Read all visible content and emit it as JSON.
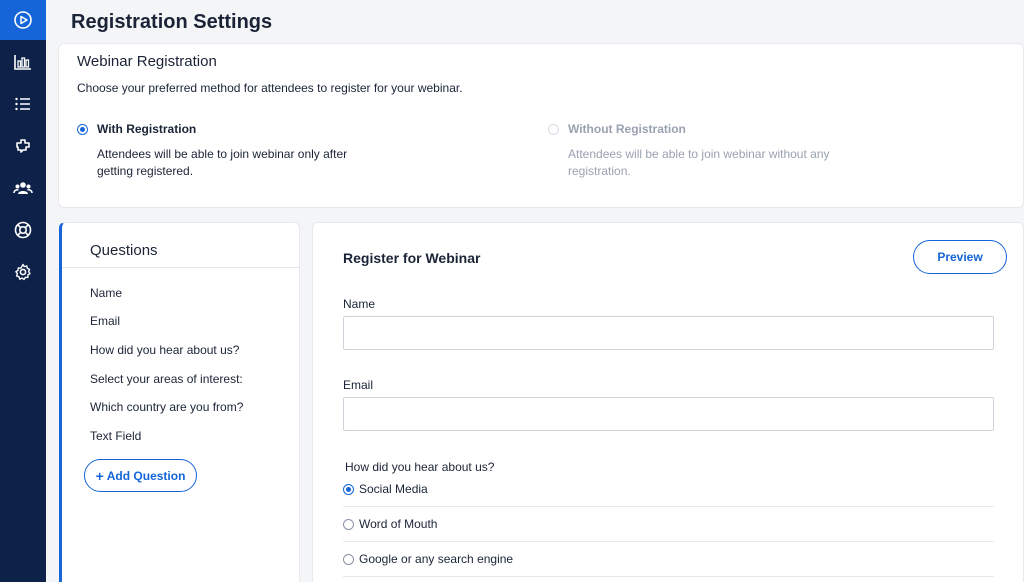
{
  "page": {
    "title": "Registration Settings"
  },
  "sidebar": {
    "items": [
      {
        "icon": "play-circle-icon",
        "active": true
      },
      {
        "icon": "bar-chart-icon",
        "active": false
      },
      {
        "icon": "list-icon",
        "active": false
      },
      {
        "icon": "integrations-icon",
        "active": false
      },
      {
        "icon": "users-icon",
        "active": false
      },
      {
        "icon": "help-lifebuoy-icon",
        "active": false
      },
      {
        "icon": "gear-icon",
        "active": false
      }
    ]
  },
  "webinar_registration": {
    "title": "Webinar Registration",
    "description": "Choose your preferred method for attendees to register for your webinar.",
    "options": [
      {
        "label": "With Registration",
        "description": "Attendees will be able to join webinar only after getting registered.",
        "selected": true,
        "enabled": true
      },
      {
        "label": "Without Registration",
        "description": "Attendees will be able to join webinar without any registration.",
        "selected": false,
        "enabled": false
      }
    ]
  },
  "questions": {
    "title": "Questions",
    "items": [
      "Name",
      "Email",
      "How did you hear about us?",
      "Select your areas of interest:",
      "Which country are you from?",
      "Text Field"
    ],
    "add_label": "Add Question"
  },
  "form_preview": {
    "title": "Register for Webinar",
    "preview_label": "Preview",
    "fields": [
      {
        "label": "Name",
        "value": ""
      },
      {
        "label": "Email",
        "value": ""
      }
    ],
    "question": {
      "label": "How did you hear about us?",
      "options": [
        {
          "label": "Social Media",
          "selected": true
        },
        {
          "label": "Word of Mouth",
          "selected": false
        },
        {
          "label": "Google or any search engine",
          "selected": false
        }
      ]
    }
  },
  "colors": {
    "sidebar": "#0e2148",
    "accent": "#1565d8",
    "text": "#1b2437",
    "muted": "#9aa1b0"
  }
}
